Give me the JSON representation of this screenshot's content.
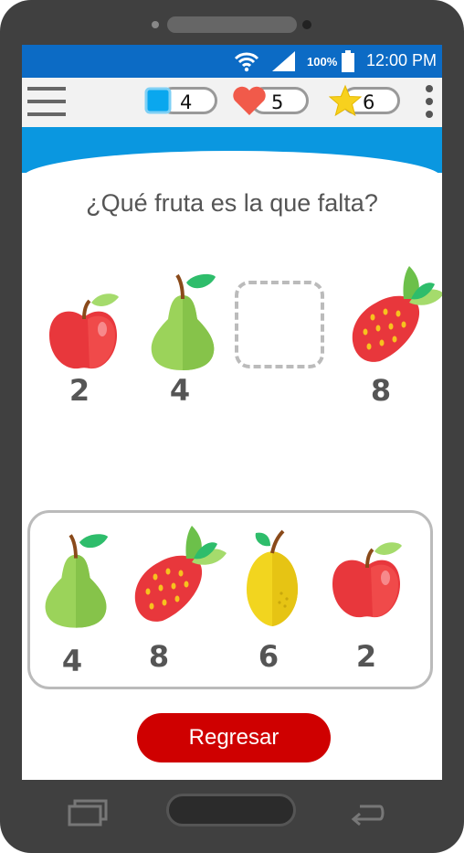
{
  "status": {
    "battery": "100%",
    "time": "12:00 PM"
  },
  "counters": {
    "squares": "4",
    "hearts": "5",
    "stars": "6"
  },
  "question": "¿Qué fruta es la que falta?",
  "sequence": [
    {
      "fruit": "apple",
      "number": "2"
    },
    {
      "fruit": "pear",
      "number": "4"
    },
    {
      "fruit": "missing",
      "number": ""
    },
    {
      "fruit": "strawberry",
      "number": "8"
    }
  ],
  "options": [
    {
      "fruit": "pear",
      "number": "4"
    },
    {
      "fruit": "strawberry",
      "number": "8"
    },
    {
      "fruit": "lemon",
      "number": "6"
    },
    {
      "fruit": "apple",
      "number": "2"
    }
  ],
  "back_button": "Regresar",
  "colors": {
    "statusbar": "#0c6bc5",
    "banner": "#0a97e0",
    "button": "#cf0000"
  },
  "icons": [
    "wifi-icon",
    "signal-icon",
    "battery-icon",
    "menu-icon",
    "square-icon",
    "heart-icon",
    "star-icon",
    "more-vert-icon",
    "recent-apps-icon",
    "home-icon",
    "back-icon"
  ]
}
